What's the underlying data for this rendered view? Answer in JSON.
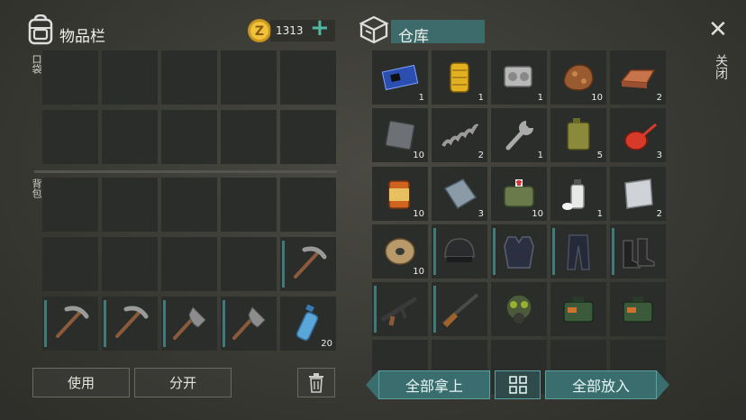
{
  "inventory": {
    "title": "物品栏",
    "pocket_label": "口袋",
    "backpack_label": "背包"
  },
  "currency": {
    "amount": "1313",
    "add_symbol": "+"
  },
  "storage": {
    "title": "仓库"
  },
  "close": {
    "label": "关闭",
    "symbol": "✕"
  },
  "actions": {
    "use": "使用",
    "split": "分开",
    "take_all": "全部拿上",
    "put_all": "全部放入"
  },
  "backpack_items": [
    {
      "icon": "pickaxe-icon"
    },
    {
      "icon": "pickaxe-icon"
    },
    {
      "icon": "pickaxe-icon"
    },
    {
      "icon": "shovel-icon"
    },
    {
      "icon": "shovel-icon"
    },
    {
      "icon": "water-bottle-icon",
      "qty": "20"
    }
  ],
  "storage_items": [
    {
      "icon": "circuit-board-icon",
      "qty": "1"
    },
    {
      "icon": "air-filter-icon",
      "qty": "1"
    },
    {
      "icon": "engine-block-icon",
      "qty": "1"
    },
    {
      "icon": "copper-ore-icon",
      "qty": "10"
    },
    {
      "icon": "copper-ingot-icon",
      "qty": "2"
    },
    {
      "icon": "metal-plate-icon",
      "qty": "10"
    },
    {
      "icon": "spring-icon",
      "qty": "2"
    },
    {
      "icon": "wrench-icon",
      "qty": "1"
    },
    {
      "icon": "jerrycan-icon",
      "qty": "5"
    },
    {
      "icon": "oil-can-icon",
      "qty": "3"
    },
    {
      "icon": "canned-food-icon",
      "qty": "10"
    },
    {
      "icon": "steel-sheet-icon",
      "qty": "3"
    },
    {
      "icon": "first-aid-bag-icon",
      "qty": "10"
    },
    {
      "icon": "spray-can-icon",
      "qty": "1"
    },
    {
      "icon": "aluminum-sheet-icon",
      "qty": "2"
    },
    {
      "icon": "wire-spool-icon",
      "qty": "10"
    },
    {
      "icon": "helmet-icon"
    },
    {
      "icon": "body-armor-icon"
    },
    {
      "icon": "tactical-pants-icon"
    },
    {
      "icon": "boots-icon"
    },
    {
      "icon": "assault-rifle-icon"
    },
    {
      "icon": "shotgun-icon"
    },
    {
      "icon": "gas-mask-icon"
    },
    {
      "icon": "ammo-box-icon"
    },
    {
      "icon": "ammo-box-icon"
    }
  ],
  "colors": {
    "accent": "#3f7b7b",
    "slot": "#2b2d2a",
    "storage_title_bg": "#3d6b6b"
  }
}
